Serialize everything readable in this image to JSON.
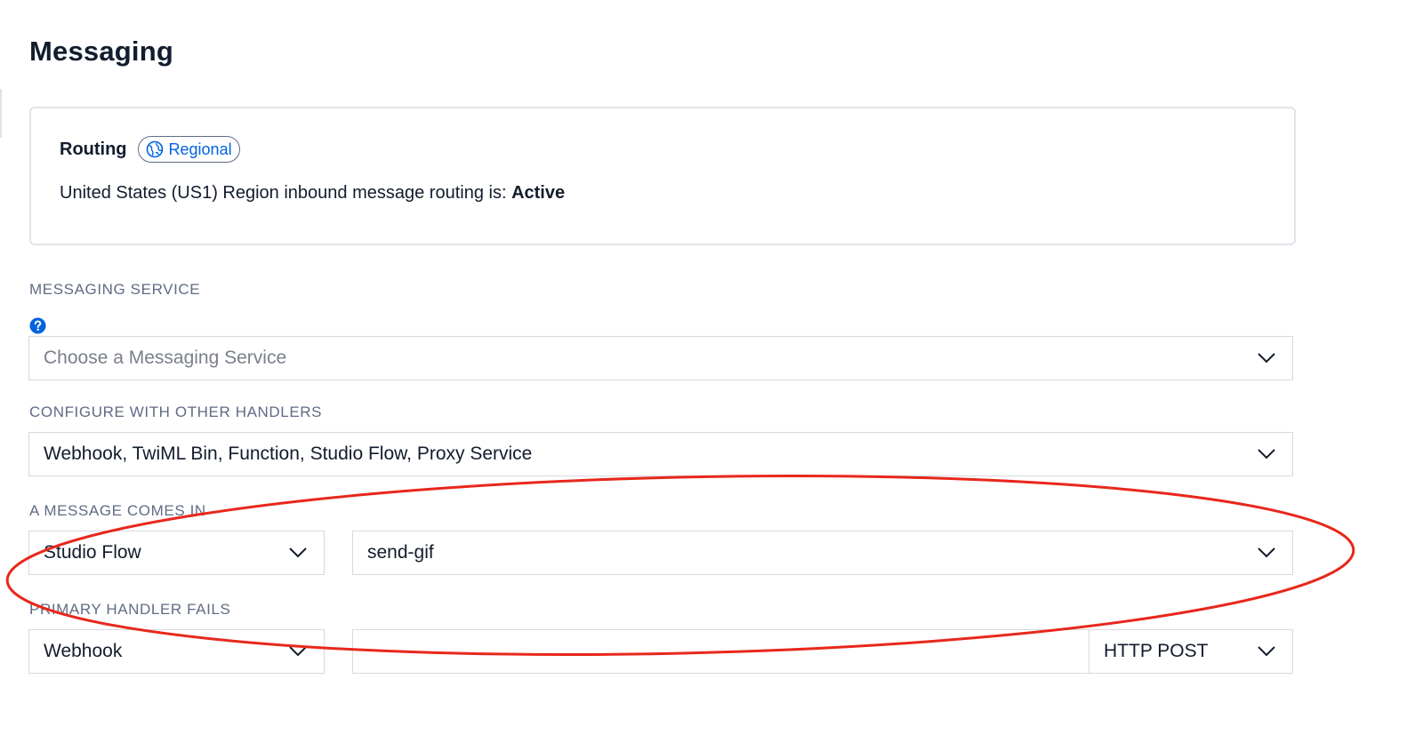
{
  "page": {
    "title": "Messaging"
  },
  "routing": {
    "label": "Routing",
    "badge": "Regional",
    "status_prefix": "United States (US1) Region inbound message routing is:",
    "status_value": "Active"
  },
  "messaging_service": {
    "label": "MESSAGING SERVICE",
    "placeholder": "Choose a Messaging Service"
  },
  "other_handlers": {
    "label": "CONFIGURE WITH OTHER HANDLERS",
    "value": "Webhook, TwiML Bin, Function, Studio Flow, Proxy Service"
  },
  "message_comes_in": {
    "label": "A MESSAGE COMES IN",
    "type_value": "Studio Flow",
    "flow_value": "send-gif"
  },
  "primary_handler_fails": {
    "label": "PRIMARY HANDLER FAILS",
    "type_value": "Webhook",
    "url_value": "",
    "method_value": "HTTP POST"
  },
  "colors": {
    "accent": "#0263e0",
    "annotation": "#e8271c"
  }
}
